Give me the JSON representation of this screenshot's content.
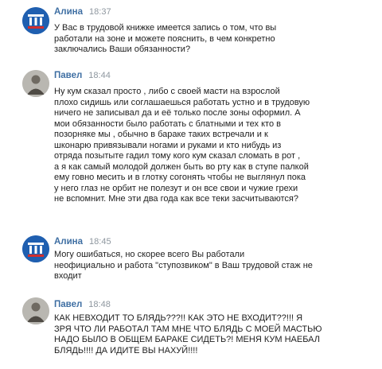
{
  "messages": [
    {
      "author": "Алина",
      "time": "18:37",
      "text": "У Вас в трудовой книжке имеется запись о том, что вы\nработали на зоне и можете пояснить, в чем конкретно\nзаключались Ваши обязанности?"
    },
    {
      "author": "Павел",
      "time": "18:44",
      "text": "Ну кум сказал просто , либо с своей масти на взрослой\nплохо сидишь или соглашаешься работать устно и в трудовую\nничего не записывал да и её только после зоны оформил. А\nмои обязанности было работать с блатными и тех кто в\nпозорняке мы , обычно в бараке таких встречали и к\nшконарю привязывали ногами и руками и кто нибудь из\nотряда позытыте гадил тому кого кум сказал сломать в рот ,\nа я как самый молодой должен быть во рту как в ступе палкой\nему говно месить и в глотку согонять чтобы не выглянул пока\nу него глаз не орбит не полезут и он все свои и чужие грехи\nне вспомнит. Мне эти два года как все теки засчитываются?"
    },
    {
      "author": "Алина",
      "time": "18:45",
      "text": "Могу ошибаться, но скорее всего Вы работали\nнеофициально и работа \"ступозвиком\" в Ваш трудовой стаж не\nвходит"
    },
    {
      "author": "Павел",
      "time": "18:48",
      "text": "КАК НЕВХОДИТ ТО БЛЯДЬ???!! КАК ЭТО НЕ ВХОДИТ??!!! Я\nЗРЯ ЧТО ЛИ РАБОТАЛ ТАМ МНЕ ЧТО БЛЯДЬ С МОЕЙ МАСТЬЮ\nНАДО БЫЛО В ОБЩЕМ БАРАКЕ СИДЕТЬ?! МЕНЯ КУМ НАЕБАЛ\nБЛЯДЬ!!!! ДА ИДИТЕ ВЫ НАХУЙ!!!!"
    }
  ]
}
